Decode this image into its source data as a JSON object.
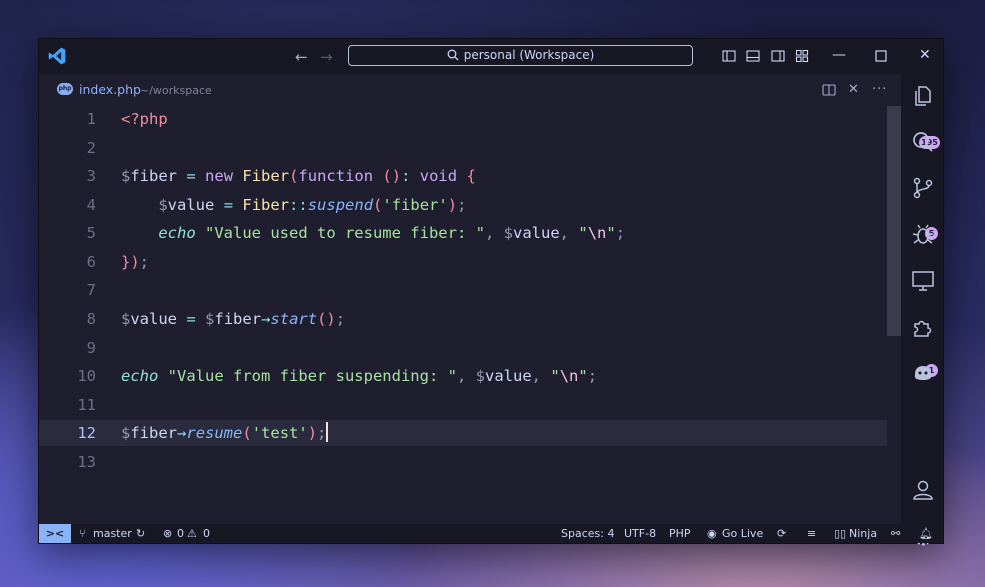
{
  "titlebar": {
    "search_text": "personal (Workspace)"
  },
  "tab": {
    "file_name": "index.php",
    "path": "~/workspace",
    "file_type_icon_text": "php"
  },
  "editor": {
    "lines": [
      {
        "num": "1"
      },
      {
        "num": "2"
      },
      {
        "num": "3"
      },
      {
        "num": "4"
      },
      {
        "num": "5"
      },
      {
        "num": "6"
      },
      {
        "num": "7"
      },
      {
        "num": "8"
      },
      {
        "num": "9"
      },
      {
        "num": "10"
      },
      {
        "num": "11"
      },
      {
        "num": "12"
      },
      {
        "num": "13"
      }
    ],
    "current_line": "12",
    "code": [
      "<?php",
      "",
      "$fiber = new Fiber(function (): void {",
      "    $value = Fiber::suspend('fiber');",
      "    echo \"Value used to resume fiber: \", $value, \"\\n\";",
      "});",
      "",
      "$value = $fiber→start();",
      "",
      "echo \"Value from fiber suspending: \", $value, \"\\n\";",
      "",
      "$fiber→resume('test');",
      ""
    ]
  },
  "activity_bar": {
    "explorer_badge": "195",
    "source_control_badge": "5",
    "extensions_badge": "1"
  },
  "status_bar": {
    "branch": "master",
    "errors": "0",
    "warnings": "0",
    "spaces": "Spaces: 4",
    "encoding": "UTF-8",
    "language": "PHP",
    "go_live": "Go Live",
    "ninja": "Ninja"
  },
  "colors": {
    "background": "#1e1e2e",
    "accent": "#89b4fa",
    "badge": "#cba6f7"
  }
}
